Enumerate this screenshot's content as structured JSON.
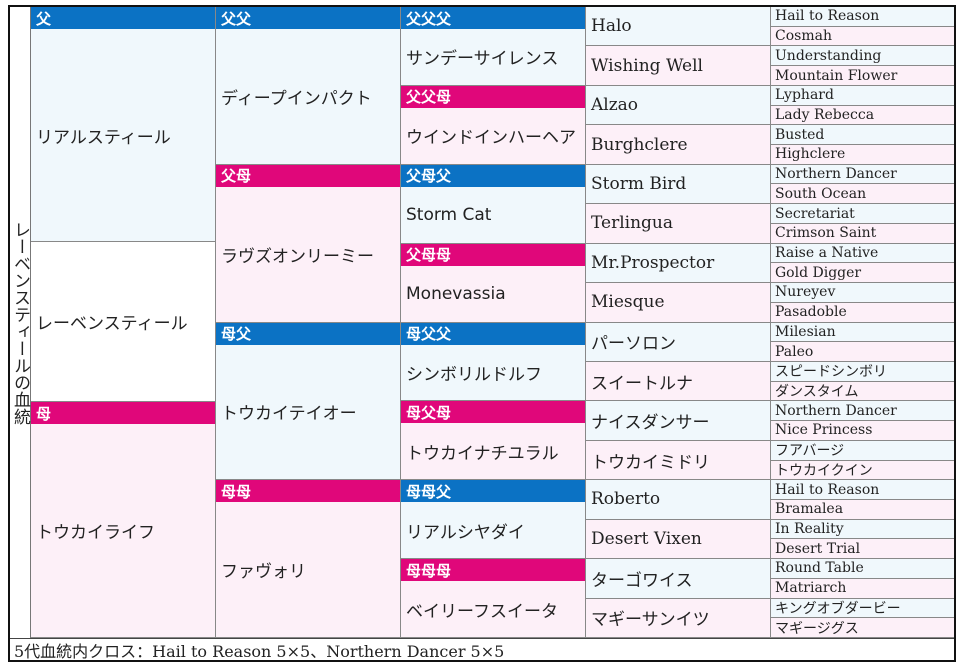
{
  "title": "レーベンスティールの血統",
  "labels": {
    "s": "父",
    "d": "母",
    "ss": "父父",
    "sd": "父母",
    "ds": "母父",
    "dd": "母母",
    "sss": "父父父",
    "ssd": "父父母",
    "sds": "父母父",
    "sdd": "父母母",
    "dss": "母父父",
    "dsd": "母父母",
    "dds": "母母父",
    "ddd": "母母母"
  },
  "gen1": {
    "sire": "リアルスティール",
    "subject_row": "レーベンスティール",
    "dam": "トウカイライフ"
  },
  "gen2": [
    "ディープインパクト",
    "ラヴズオンリーミー",
    "トウカイテイオー",
    "ファヴォリ"
  ],
  "gen3": [
    "サンデーサイレンス",
    "ウインドインハーヘア",
    "Storm Cat",
    "Monevassia",
    "シンボリルドルフ",
    "トウカイナチユラル",
    "リアルシヤダイ",
    "ベイリーフスイータ"
  ],
  "gen4": [
    "Halo",
    "Wishing Well",
    "Alzao",
    "Burghclere",
    "Storm Bird",
    "Terlingua",
    "Mr.Prospector",
    "Miesque",
    "パーソロン",
    "スイートルナ",
    "ナイスダンサー",
    "トウカイミドリ",
    "Roberto",
    "Desert Vixen",
    "ターゴワイス",
    "マギーサンイツ"
  ],
  "gen5": [
    "Hail to Reason",
    "Cosmah",
    "Understanding",
    "Mountain Flower",
    "Lyphard",
    "Lady Rebecca",
    "Busted",
    "Highclere",
    "Northern Dancer",
    "South Ocean",
    "Secretariat",
    "Crimson Saint",
    "Raise a Native",
    "Gold Digger",
    "Nureyev",
    "Pasadoble",
    "Milesian",
    "Paleo",
    "スピードシンボリ",
    "ダンスタイム",
    "Northern Dancer",
    "Nice Princess",
    "フアバージ",
    "トウカイクイン",
    "Hail to Reason",
    "Bramalea",
    "In Reality",
    "Desert Trial",
    "Round Table",
    "Matriarch",
    "キングオブダービー",
    "マギージグス"
  ],
  "footer": "5代血統内クロス：Hail to Reason 5×5、Northern Dancer 5×5",
  "colors": {
    "sire_header": "#0b72c4",
    "dam_header": "#e0077a",
    "sire_bg": "#f0f8fc",
    "dam_bg": "#fdf0f8"
  }
}
